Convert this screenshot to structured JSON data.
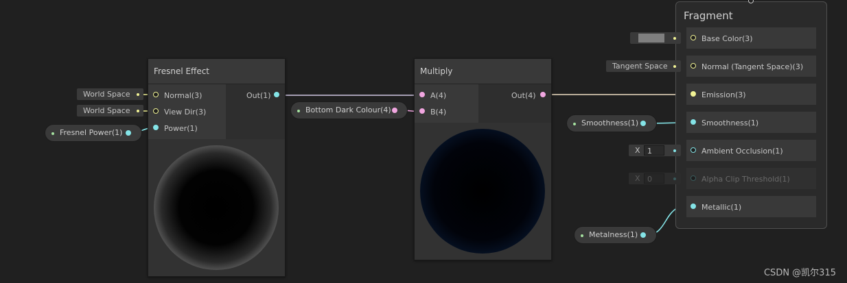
{
  "colors": {
    "vector3": "#f1f395",
    "vector4": "#f1a6e0",
    "float": "#84e4e7"
  },
  "fresnel": {
    "title": "Fresnel Effect",
    "inputs": [
      "Normal(3)",
      "View Dir(3)",
      "Power(1)"
    ],
    "output": "Out(1)",
    "normal_field": "World Space",
    "viewdir_field": "World Space"
  },
  "fresnel_power": {
    "label": "Fresnel Power(1)"
  },
  "bottom_dark": {
    "label": "Bottom Dark Colour(4)"
  },
  "multiply": {
    "title": "Multiply",
    "inputs": [
      "A(4)",
      "B(4)"
    ],
    "output": "Out(4)"
  },
  "smoothness_prop": {
    "label": "Smoothness(1)"
  },
  "metalness_prop": {
    "label": "Metalness(1)"
  },
  "fragment": {
    "title": "Fragment",
    "slots": [
      "Base Color(3)",
      "Normal (Tangent Space)(3)",
      "Emission(3)",
      "Smoothness(1)",
      "Ambient Occlusion(1)",
      "Alpha Clip Threshold(1)",
      "Metallic(1)"
    ],
    "normal_space": "Tangent Space",
    "ao": {
      "axis": "X",
      "value": "1"
    },
    "alpha_clip": {
      "axis": "X",
      "value": "0"
    }
  },
  "watermark": "CSDN @凯尔315"
}
